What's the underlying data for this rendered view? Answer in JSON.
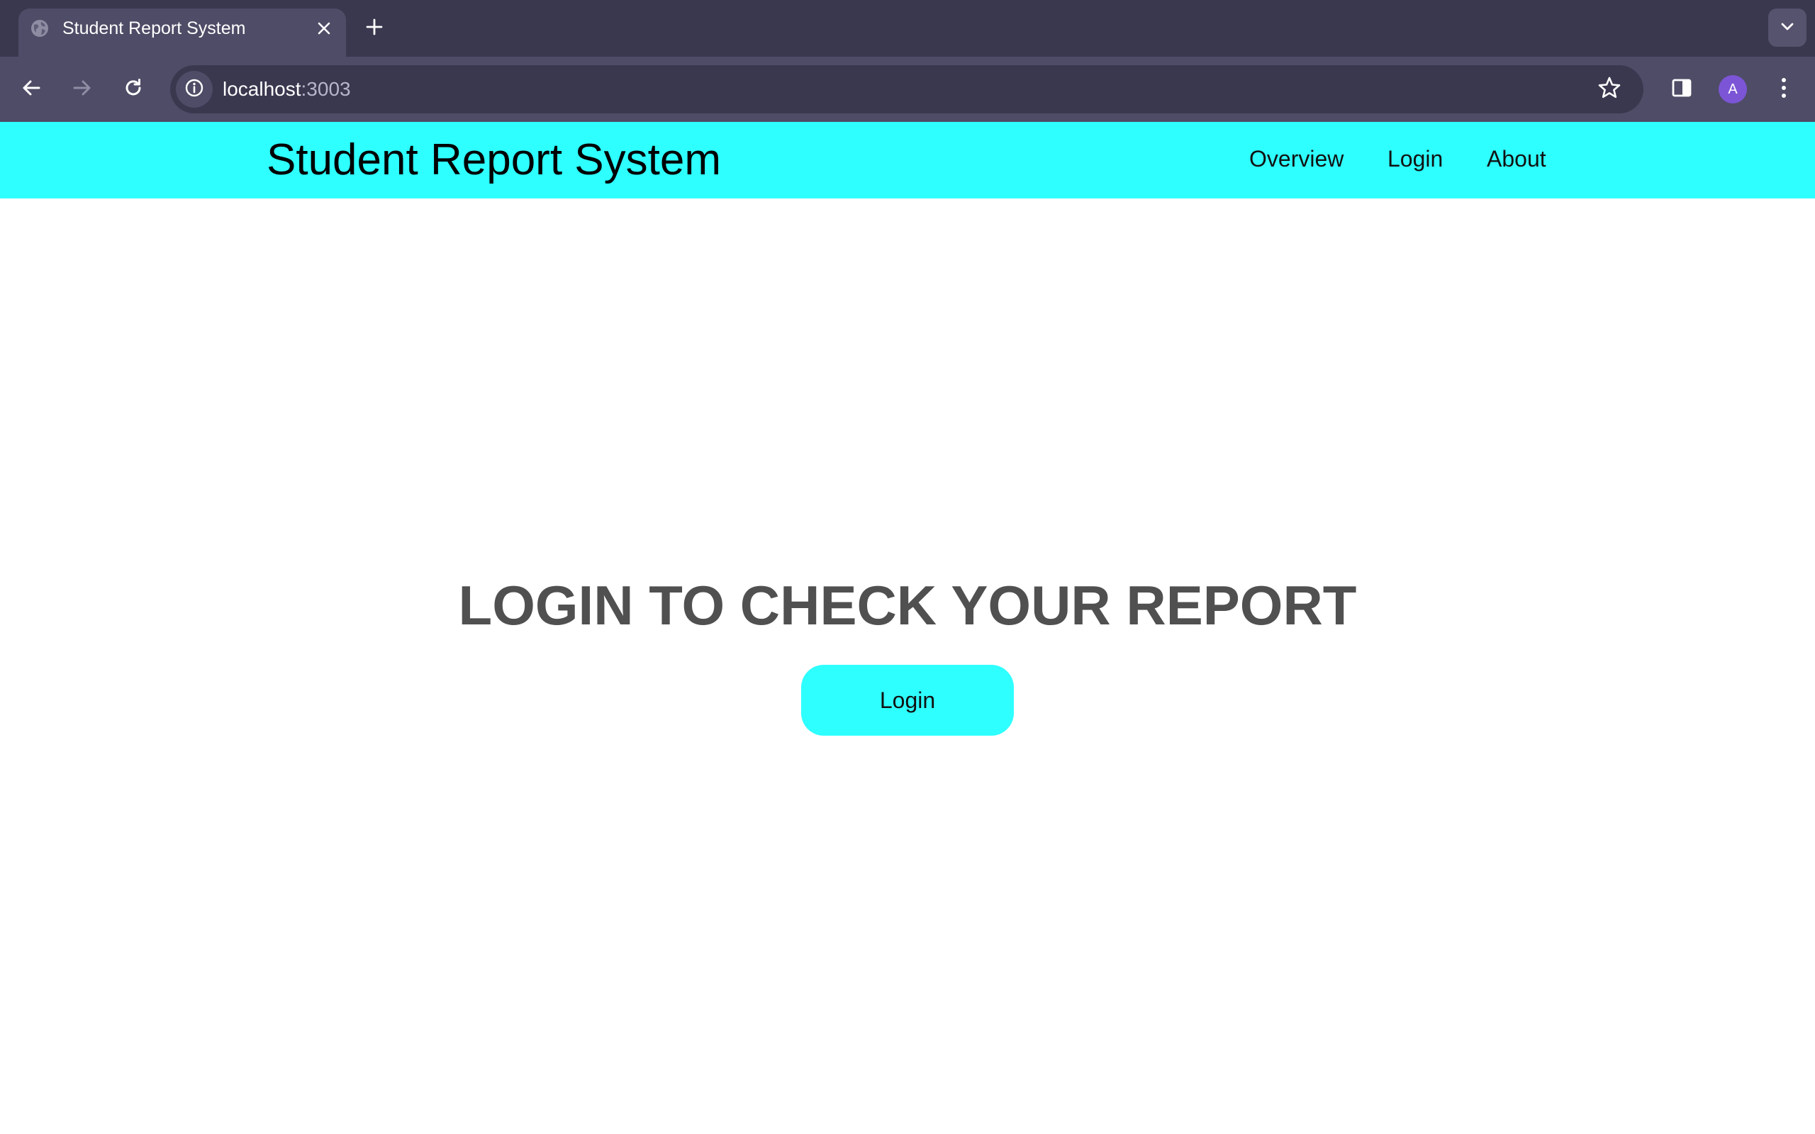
{
  "browser": {
    "tab": {
      "title": "Student Report System",
      "favicon": "globe-icon",
      "close_icon": "close-icon"
    },
    "new_tab_icon": "plus-icon",
    "tab_search_icon": "chevron-down-icon",
    "toolbar": {
      "back_icon": "arrow-left-icon",
      "forward_icon": "arrow-right-icon",
      "reload_icon": "reload-icon",
      "site_info_icon": "info-icon",
      "bookmark_icon": "star-icon",
      "side_panel_icon": "side-panel-icon",
      "menu_icon": "kebab-menu-icon"
    },
    "url": {
      "host": "localhost",
      "port": ":3003"
    },
    "profile_initial": "A"
  },
  "site": {
    "brand": "Student Report System",
    "nav": [
      {
        "label": "Overview"
      },
      {
        "label": "Login"
      },
      {
        "label": "About"
      }
    ]
  },
  "hero": {
    "title": "LOGIN TO CHECK YOUR REPORT",
    "button_label": "Login"
  },
  "colors": {
    "accent": "#2effff",
    "tabstrip": "#3a384f",
    "toolbar": "#4e4c66",
    "heading_text": "#505050",
    "avatar": "#7c55d6"
  }
}
